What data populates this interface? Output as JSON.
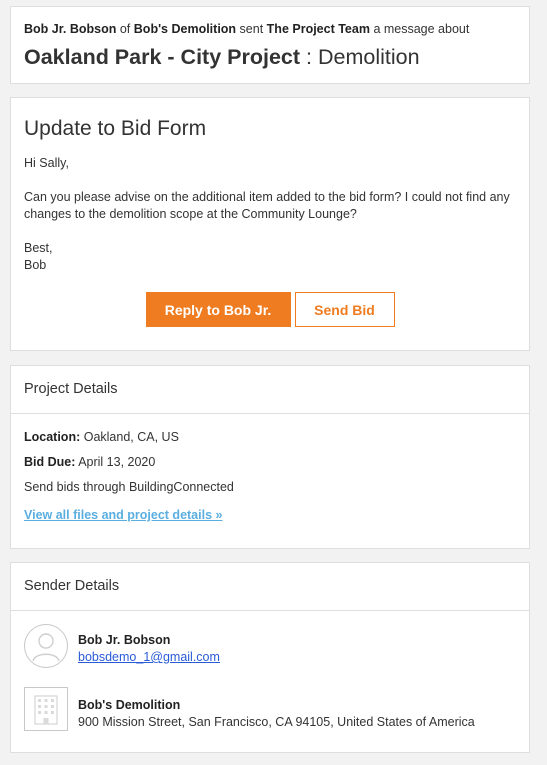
{
  "header": {
    "sender_name": "Bob Jr. Bobson",
    "of_text": "of",
    "company": "Bob's Demolition",
    "sent_text": "sent",
    "recipient": "The Project Team",
    "about_text": "a message about",
    "project_name": "Oakland Park - City Project",
    "separator": ":",
    "trade": "Demolition"
  },
  "message": {
    "title": "Update to Bid Form",
    "greeting": "Hi Sally,",
    "body": "Can you please advise on the additional item added to the bid form? I could not find any changes to the demolition scope at the Community Lounge?",
    "closing": "Best,",
    "signature": "Bob",
    "reply_label": "Reply to Bob Jr.",
    "send_bid_label": "Send Bid"
  },
  "project_details": {
    "heading": "Project Details",
    "location_label": "Location:",
    "location_value": "Oakland, CA, US",
    "bid_due_label": "Bid Due:",
    "bid_due_value": "April 13, 2020",
    "send_note": "Send bids through BuildingConnected",
    "link_text": "View all files and project details »"
  },
  "sender_details": {
    "heading": "Sender Details",
    "person_name": "Bob Jr. Bobson",
    "person_email": "bobsdemo_1@gmail.com",
    "company_name": "Bob's Demolition",
    "company_address": "900 Mission Street, San Francisco, CA 94105, United States of America"
  },
  "colors": {
    "accent": "#ef7c21",
    "link": "#5aaee0",
    "email_link": "#2a5bd7"
  },
  "icons": {
    "avatar": "user-avatar-icon",
    "company": "building-icon"
  }
}
